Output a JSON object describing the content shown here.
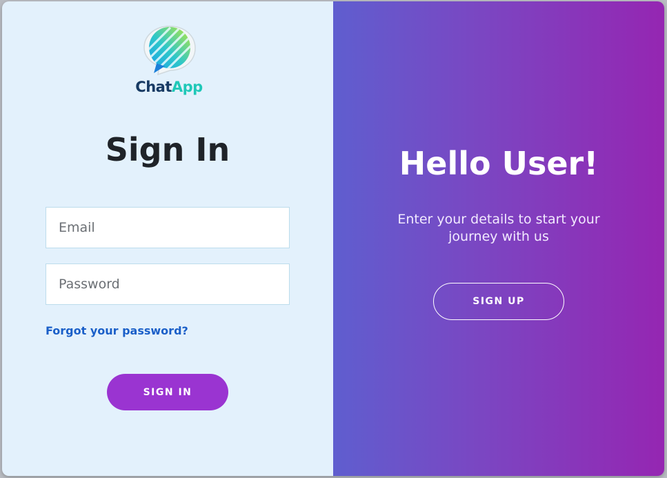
{
  "brand": {
    "name_part1": "Chat",
    "name_part2": "App",
    "logo_icon": "chat-bubble-logo-icon"
  },
  "signin": {
    "title": "Sign In",
    "email_placeholder": "Email",
    "password_placeholder": "Password",
    "forgot_label": "Forgot your password?",
    "button_label": "SIGN IN"
  },
  "welcome": {
    "title": "Hello User!",
    "subtitle": "Enter your details to start your journey with us",
    "button_label": "SIGN UP"
  },
  "colors": {
    "left_bg": "#e3f1fc",
    "gradient_start": "#5f5ecf",
    "gradient_end": "#9526b2",
    "primary_button": "#9a34d1",
    "link": "#1a5fc8",
    "heading": "#1f2328"
  }
}
